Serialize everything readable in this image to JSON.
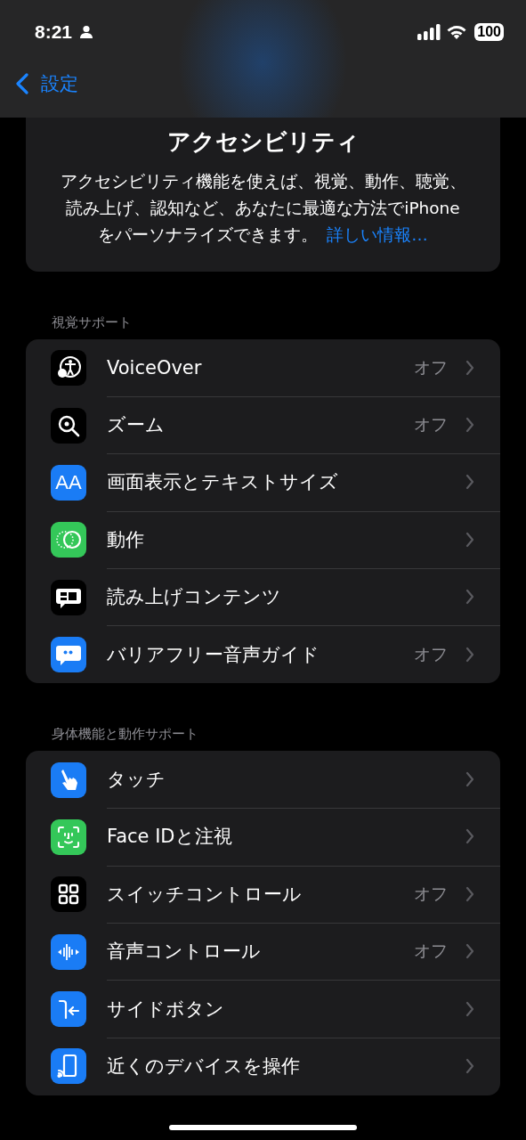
{
  "status_bar": {
    "time": "8:21",
    "battery": "100"
  },
  "nav": {
    "back_label": "設定"
  },
  "header": {
    "title": "アクセシビリティ",
    "description": "アクセシビリティ機能を使えば、視覚、動作、聴覚、読み上げ、認知など、あなたに最適な方法でiPhoneをパーソナライズできます。",
    "link": "詳しい情報…"
  },
  "sections": [
    {
      "title": "視覚サポート",
      "items": [
        {
          "label": "VoiceOver",
          "value": "オフ",
          "kind": "accessibility",
          "color": "#000000"
        },
        {
          "label": "ズーム",
          "value": "オフ",
          "kind": "zoom",
          "color": "#000000"
        },
        {
          "label": "画面表示とテキストサイズ",
          "kind": "text-size",
          "glyph": "AA",
          "color": "#1a7cf5"
        },
        {
          "label": "動作",
          "kind": "motion",
          "color": "#34c759"
        },
        {
          "label": "読み上げコンテンツ",
          "kind": "spoken",
          "color": "#000000"
        },
        {
          "label": "バリアフリー音声ガイド",
          "value": "オフ",
          "kind": "quote",
          "color": "#1a7cf5"
        }
      ]
    },
    {
      "title": "身体機能と動作サポート",
      "items": [
        {
          "label": "タッチ",
          "kind": "touch",
          "color": "#1a7cf5"
        },
        {
          "label": "Face IDと注視",
          "kind": "face",
          "color": "#34c759"
        },
        {
          "label": "スイッチコントロール",
          "value": "オフ",
          "kind": "grid",
          "color": "#000000"
        },
        {
          "label": "音声コントロール",
          "value": "オフ",
          "kind": "voice",
          "color": "#1a7cf5"
        },
        {
          "label": "サイドボタン",
          "kind": "side",
          "color": "#1a7cf5"
        },
        {
          "label": "近くのデバイスを操作",
          "kind": "device",
          "color": "#1a7cf5"
        }
      ]
    }
  ]
}
